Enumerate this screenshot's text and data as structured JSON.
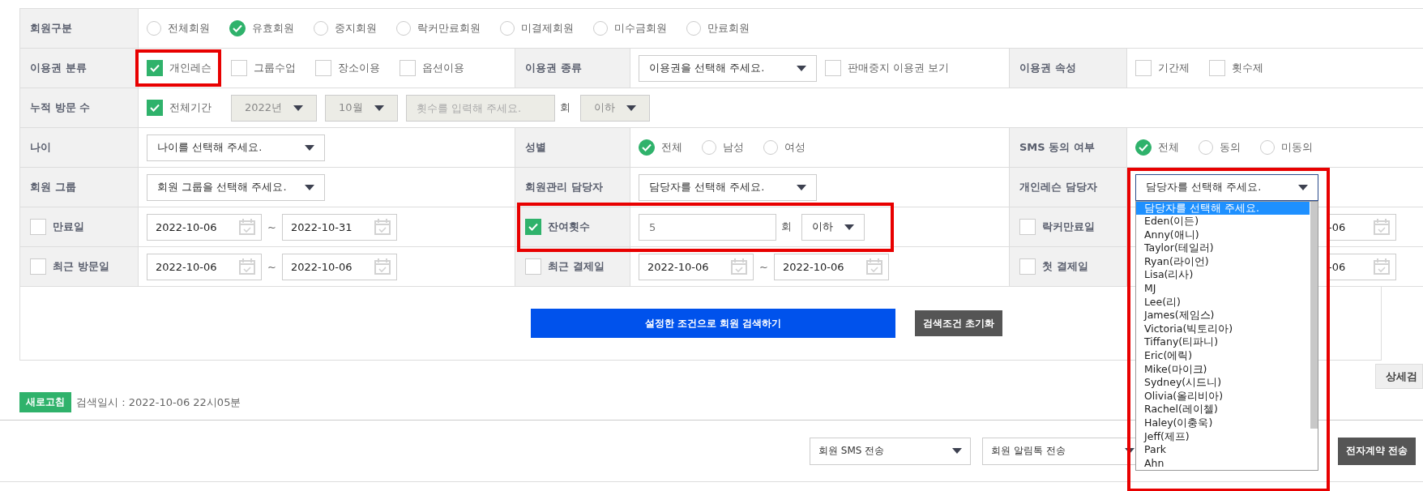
{
  "rows": [
    {
      "pairs": [
        {
          "label": "회원구분",
          "items": [
            {
              "kind": "radio",
              "label": "전체회원",
              "selected": false
            },
            {
              "kind": "radio",
              "label": "유효회원",
              "selected": true
            },
            {
              "kind": "radio",
              "label": "중지회원",
              "selected": false
            },
            {
              "kind": "radio",
              "label": "락커만료회원",
              "selected": false
            },
            {
              "kind": "radio",
              "label": "미결제회원",
              "selected": false
            },
            {
              "kind": "radio",
              "label": "미수금회원",
              "selected": false
            },
            {
              "kind": "radio",
              "label": "만료회원",
              "selected": false
            }
          ]
        }
      ]
    },
    {
      "pairs": [
        {
          "label": "이용권 분류",
          "items": [
            {
              "kind": "checkbox",
              "label": "개인레슨",
              "checked": true,
              "highlighted": true
            },
            {
              "kind": "checkbox",
              "label": "그룹수업",
              "checked": false
            },
            {
              "kind": "checkbox",
              "label": "장소이용",
              "checked": false
            },
            {
              "kind": "checkbox",
              "label": "옵션이용",
              "checked": false
            }
          ]
        },
        {
          "label": "이용권 종류",
          "items": [
            {
              "kind": "select",
              "value": "이용권을 선택해 주세요.",
              "disabled": false
            },
            {
              "kind": "checkbox",
              "label": "판매중지 이용권 보기",
              "checked": false
            }
          ]
        },
        {
          "label": "이용권 속성",
          "items": [
            {
              "kind": "checkbox",
              "label": "기간제",
              "checked": false
            },
            {
              "kind": "checkbox",
              "label": "횟수제",
              "checked": false
            }
          ]
        }
      ]
    },
    {
      "pairs": [
        {
          "label": "누적 방문 수",
          "items": [
            {
              "kind": "checkbox",
              "label": "전체기간",
              "checked": true
            },
            {
              "kind": "select",
              "value": "2022년",
              "disabled": true
            },
            {
              "kind": "select",
              "value": "10월",
              "disabled": true
            },
            {
              "kind": "input",
              "placeholder": "횟수를 입력해 주세요.",
              "disabled": true
            },
            {
              "kind": "unit",
              "text": "회"
            },
            {
              "kind": "select",
              "value": "이하",
              "disabled": true
            }
          ]
        }
      ]
    },
    {
      "pairs": [
        {
          "label": "나이",
          "items": [
            {
              "kind": "select",
              "value": "나이를 선택해 주세요.",
              "disabled": false
            }
          ]
        },
        {
          "label": "성별",
          "items": [
            {
              "kind": "radio",
              "label": "전체",
              "selected": true
            },
            {
              "kind": "radio",
              "label": "남성",
              "selected": false
            },
            {
              "kind": "radio",
              "label": "여성",
              "selected": false
            }
          ]
        },
        {
          "label": "SMS 동의 여부",
          "items": [
            {
              "kind": "radio",
              "label": "전체",
              "selected": true
            },
            {
              "kind": "radio",
              "label": "동의",
              "selected": false
            },
            {
              "kind": "radio",
              "label": "미동의",
              "selected": false
            }
          ]
        }
      ]
    },
    {
      "pairs": [
        {
          "label": "회원 그룹",
          "items": [
            {
              "kind": "select",
              "value": "회원 그룹을 선택해 주세요.",
              "disabled": false
            }
          ]
        },
        {
          "label": "회원관리 담당자",
          "items": [
            {
              "kind": "select",
              "value": "담당자를 선택해 주세요.",
              "disabled": false
            }
          ]
        },
        {
          "label": "개인레슨 담당자",
          "items": [
            {
              "kind": "select",
              "value": "담당자를 선택해 주세요.",
              "disabled": false,
              "highlighted": true,
              "open": true,
              "options": [
                {
                  "label": "담당자를 선택해 주세요.",
                  "selected": true
                },
                {
                  "label": "Eden(이든)",
                  "selected": false
                },
                {
                  "label": "Anny(애니)",
                  "selected": false
                },
                {
                  "label": "Taylor(테일러)",
                  "selected": false
                },
                {
                  "label": "Ryan(라이언)",
                  "selected": false
                },
                {
                  "label": "Lisa(리사)",
                  "selected": false
                },
                {
                  "label": "MJ",
                  "selected": false
                },
                {
                  "label": "Lee(리)",
                  "selected": false
                },
                {
                  "label": "James(제임스)",
                  "selected": false
                },
                {
                  "label": "Victoria(빅토리아)",
                  "selected": false
                },
                {
                  "label": "Tiffany(티파니)",
                  "selected": false
                },
                {
                  "label": "Eric(에릭)",
                  "selected": false
                },
                {
                  "label": "Mike(마이크)",
                  "selected": false
                },
                {
                  "label": "Sydney(시드니)",
                  "selected": false
                },
                {
                  "label": "Olivia(올리비아)",
                  "selected": false
                },
                {
                  "label": "Rachel(레이첼)",
                  "selected": false
                },
                {
                  "label": "Haley(이충욱)",
                  "selected": false
                },
                {
                  "label": "Jeff(제프)",
                  "selected": false
                },
                {
                  "label": "Park",
                  "selected": false
                },
                {
                  "label": "Ahn",
                  "selected": false
                }
              ]
            }
          ]
        }
      ]
    },
    {
      "pairs": [
        {
          "label": "만료일",
          "checked": false,
          "items": [
            {
              "kind": "date",
              "value": "2022-10-06"
            },
            {
              "kind": "sep",
              "text": "~"
            },
            {
              "kind": "date",
              "value": "2022-10-31"
            }
          ]
        },
        {
          "label": "잔여횟수",
          "checked": true,
          "highlighted": true,
          "items": [
            {
              "kind": "input",
              "value": "5",
              "disabled": false
            },
            {
              "kind": "unit",
              "text": "회"
            },
            {
              "kind": "select",
              "value": "이하",
              "disabled": false
            }
          ]
        },
        {
          "label": "락커만료일",
          "checked": false,
          "items": [
            {
              "kind": "date",
              "value": "-06",
              "cut": true
            }
          ]
        }
      ]
    },
    {
      "pairs": [
        {
          "label": "최근 방문일",
          "checked": false,
          "items": [
            {
              "kind": "date",
              "value": "2022-10-06"
            },
            {
              "kind": "sep",
              "text": "~"
            },
            {
              "kind": "date",
              "value": "2022-10-06"
            }
          ]
        },
        {
          "label": "최근 결제일",
          "checked": false,
          "items": [
            {
              "kind": "date",
              "value": "2022-10-06"
            },
            {
              "kind": "sep",
              "text": "~"
            },
            {
              "kind": "date",
              "value": "2022-10-06"
            }
          ]
        },
        {
          "label": "첫 결제일",
          "checked": false,
          "items": [
            {
              "kind": "date",
              "value": "-06",
              "cut": true
            }
          ]
        }
      ]
    }
  ],
  "search_button": "설정한 조건으로 회원 검색하기",
  "reset_button": "검색조건 초기화",
  "detail_tab": "상세검",
  "refresh_button": "새로고침",
  "search_time": "검색일시 : 2022-10-06 22시05분",
  "toolbar": {
    "selects": [
      "회원 SMS 전송",
      "회원 알림톡 전송"
    ],
    "button": "전자계약 전송"
  }
}
